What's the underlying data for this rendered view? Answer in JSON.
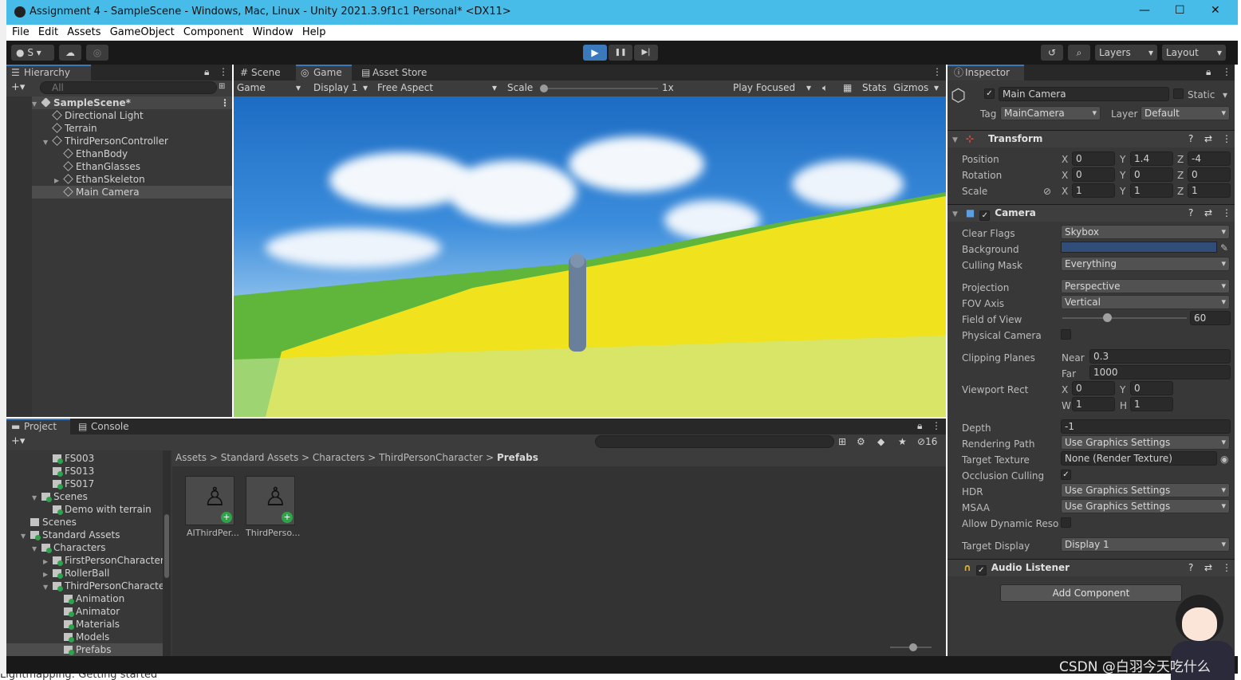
{
  "window": {
    "title": "Assignment 4 - SampleScene - Windows, Mac, Linux - Unity 2021.3.9f1c1 Personal* <DX11>",
    "min": "—",
    "max": "☐",
    "close": "✕"
  },
  "menu": [
    "File",
    "Edit",
    "Assets",
    "GameObject",
    "Component",
    "Window",
    "Help"
  ],
  "toolbar": {
    "account": "S",
    "play": "▶",
    "pause": "❚❚",
    "step": "▶|",
    "layers": "Layers",
    "layout": "Layout"
  },
  "hierarchy": {
    "tab": "Hierarchy",
    "search_placeholder": "All",
    "scene": "SampleScene*",
    "items": [
      "Directional Light",
      "Terrain",
      "ThirdPersonController",
      "EthanBody",
      "EthanGlasses",
      "EthanSkeleton",
      "Main Camera"
    ]
  },
  "gameview": {
    "tabs": [
      "Scene",
      "Game",
      "Asset Store"
    ],
    "display_mode": "Game",
    "display": "Display 1",
    "aspect": "Free Aspect",
    "scale_label": "Scale",
    "scale_value": "1x",
    "play_focused": "Play Focused",
    "stats": "Stats",
    "gizmos": "Gizmos"
  },
  "project": {
    "tabs": [
      "Project",
      "Console"
    ],
    "count": "16",
    "tree": [
      "FS003",
      "FS013",
      "FS017",
      "Scenes",
      "Demo with terrain",
      "Scenes",
      "Standard Assets",
      "Characters",
      "FirstPersonCharacter",
      "RollerBall",
      "ThirdPersonCharacter",
      "Animation",
      "Animator",
      "Materials",
      "Models",
      "Prefabs"
    ],
    "breadcrumb": [
      "Assets",
      "Standard Assets",
      "Characters",
      "ThirdPersonCharacter",
      "Prefabs"
    ],
    "assets": [
      "AIThirdPer...",
      "ThirdPerso..."
    ]
  },
  "inspector": {
    "tab": "Inspector",
    "name": "Main Camera",
    "static": "Static",
    "tag_label": "Tag",
    "tag": "MainCamera",
    "layer_label": "Layer",
    "layer": "Default",
    "transform": {
      "title": "Transform",
      "rows": [
        {
          "label": "Position",
          "x": "0",
          "y": "1.4",
          "z": "-4"
        },
        {
          "label": "Rotation",
          "x": "0",
          "y": "0",
          "z": "0"
        },
        {
          "label": "Scale",
          "x": "1",
          "y": "1",
          "z": "1"
        }
      ]
    },
    "camera": {
      "title": "Camera",
      "clear_flags_label": "Clear Flags",
      "clear_flags": "Skybox",
      "background_label": "Background",
      "background_color": "#314d79",
      "culling_label": "Culling Mask",
      "culling": "Everything",
      "projection_label": "Projection",
      "projection": "Perspective",
      "fov_axis_label": "FOV Axis",
      "fov_axis": "Vertical",
      "fov_label": "Field of View",
      "fov": "60",
      "fov_fraction": 0.33,
      "physical_label": "Physical Camera",
      "clipping_label": "Clipping Planes",
      "near_label": "Near",
      "near": "0.3",
      "far_label": "Far",
      "far": "1000",
      "viewport_label": "Viewport Rect",
      "vx": "0",
      "vy": "0",
      "vw": "1",
      "vh": "1",
      "depth_label": "Depth",
      "depth": "-1",
      "rendering_label": "Rendering Path",
      "rendering": "Use Graphics Settings",
      "target_label": "Target Texture",
      "target": "None (Render Texture)",
      "occlusion_label": "Occlusion Culling",
      "hdr_label": "HDR",
      "hdr": "Use Graphics Settings",
      "msaa_label": "MSAA",
      "msaa": "Use Graphics Settings",
      "dynres_label": "Allow Dynamic Resolu",
      "display_label": "Target Display",
      "display": "Display 1"
    },
    "audio": {
      "title": "Audio Listener"
    },
    "add_component": "Add Component"
  },
  "watermark": "CSDN @白羽今天吃什么",
  "bottom_text": "Lightmapping: Getting started"
}
